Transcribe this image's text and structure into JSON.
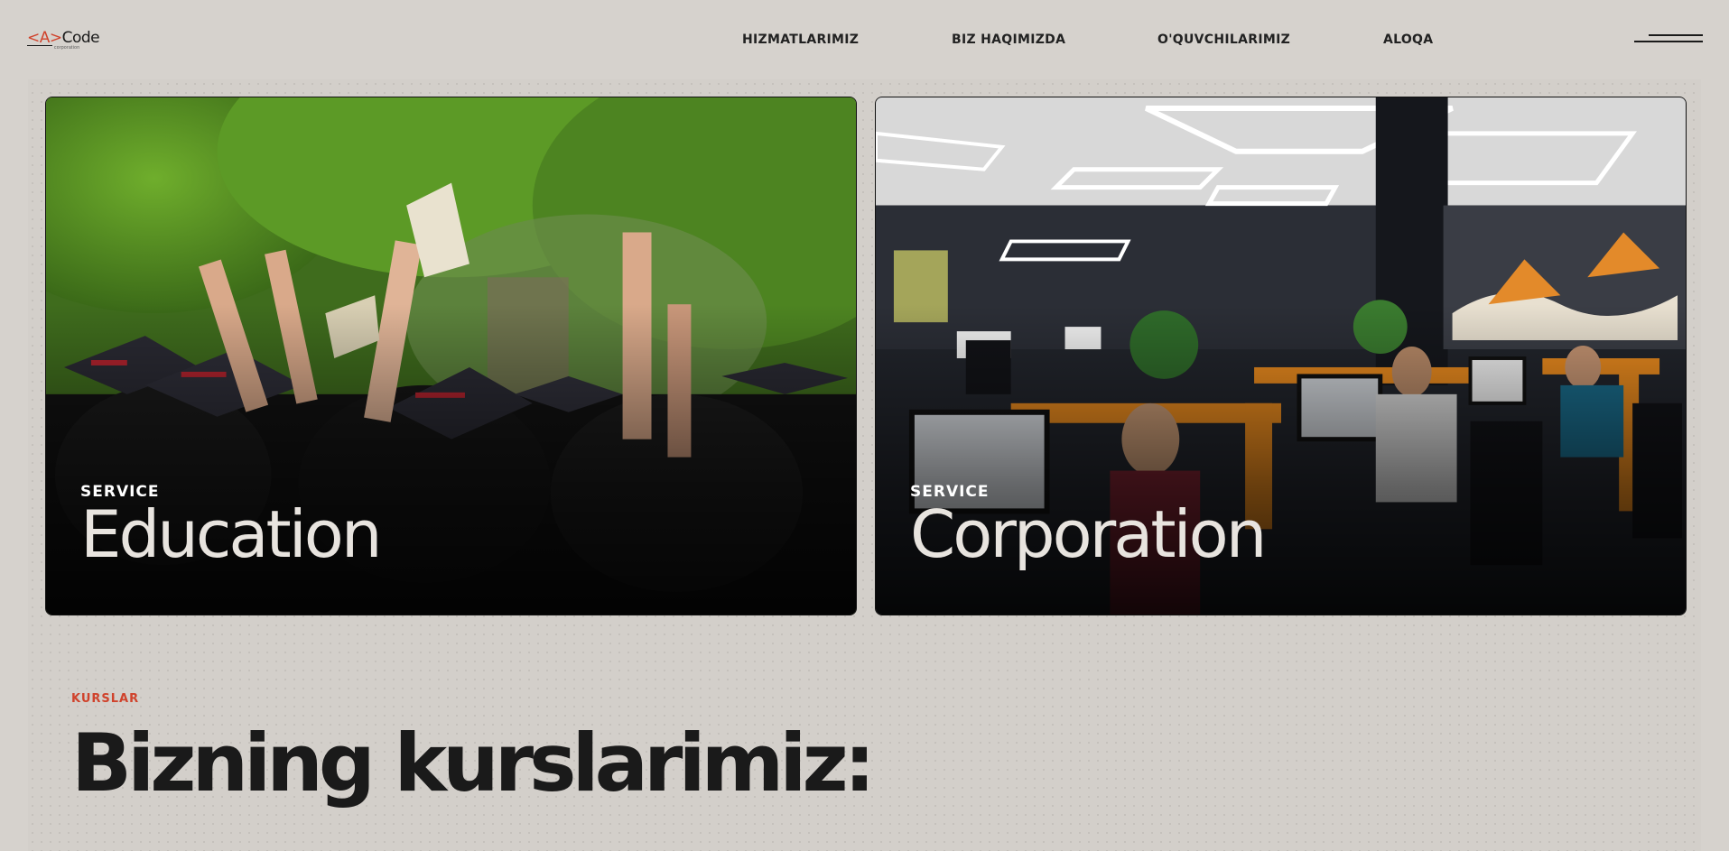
{
  "logo": {
    "bracket_open": "<A>",
    "name": "Code",
    "sub": "corporation"
  },
  "nav": {
    "items": [
      {
        "label": "HIZMATLARIMIZ"
      },
      {
        "label": "BIZ HAQIMIZDA"
      },
      {
        "label": "O'QUVCHILARIMIZ"
      },
      {
        "label": "ALOQA"
      }
    ]
  },
  "icons": {
    "menu": "hamburger-menu-icon"
  },
  "cards": [
    {
      "kicker": "SERVICE",
      "title": "Education",
      "image": "graduation-ceremony-photo"
    },
    {
      "kicker": "SERVICE",
      "title": "Corporation",
      "image": "office-workspace-photo"
    }
  ],
  "courses": {
    "kicker": "KURSLAR",
    "title": "Bizning kurslarimiz:"
  },
  "colors": {
    "background": "#d6d2cd",
    "accent": "#d0432c",
    "text": "#1a1a1a"
  }
}
